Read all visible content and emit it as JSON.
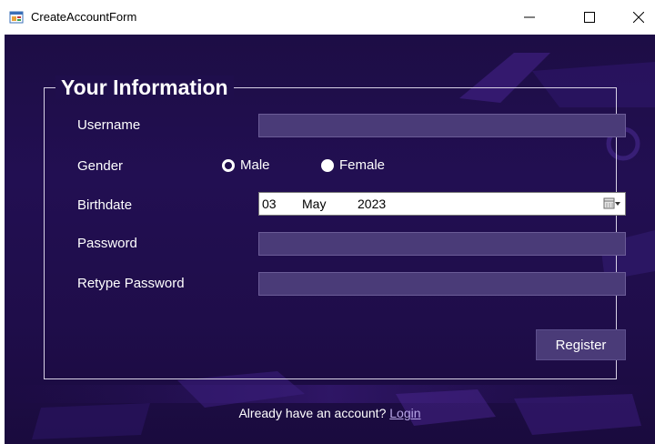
{
  "window": {
    "title": "CreateAccountForm",
    "icon": "app-form-icon",
    "controls": {
      "minimize": "minimize-icon",
      "maximize": "maximize-icon",
      "close": "close-icon"
    }
  },
  "form": {
    "group_title": "Your Information",
    "fields": {
      "username": {
        "label": "Username",
        "value": ""
      },
      "gender": {
        "label": "Gender",
        "options": [
          {
            "label": "Male",
            "selected": true
          },
          {
            "label": "Female",
            "selected": false
          }
        ]
      },
      "birthdate": {
        "label": "Birthdate",
        "day": "03",
        "month": "May",
        "year": "2023"
      },
      "password": {
        "label": "Password",
        "value": ""
      },
      "retype_password": {
        "label": "Retype Password",
        "value": ""
      }
    },
    "register_label": "Register"
  },
  "footer": {
    "prompt": "Already have an account?",
    "link": "Login"
  },
  "colors": {
    "background": "#1f0d4a",
    "field": "#4a3b78",
    "accent_link": "#b7a6e6"
  }
}
